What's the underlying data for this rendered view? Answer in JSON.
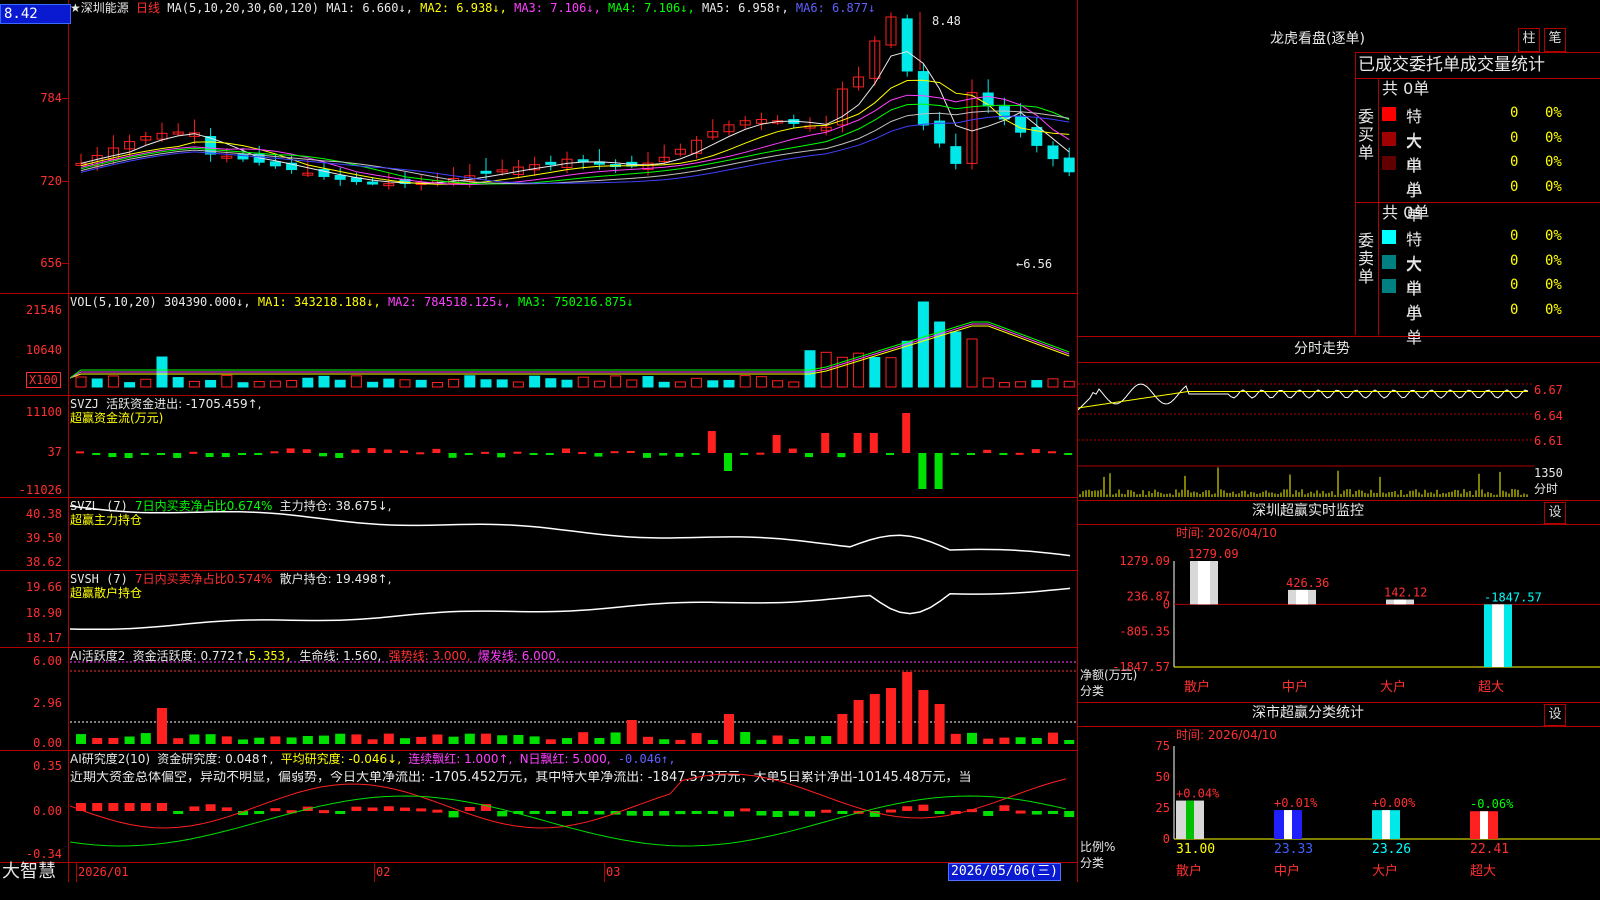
{
  "price_box": "8.42",
  "footer_brand": "大智慧",
  "dates": {
    "jan": "2026/01",
    "feb": "02",
    "mar": "03",
    "cursor": "2026/05/06(三)"
  },
  "main_chart": {
    "star": "★",
    "name": "深圳能源",
    "period": "日线",
    "ma_params": "MA(5,10,20,30,60,120)",
    "ma1": "MA1: 6.660↓,",
    "ma2": "MA2: 6.938↓,",
    "ma3": "MA3: 7.106↓,",
    "ma4": "MA4: 7.106↓,",
    "ma5": "MA5: 6.958↑,",
    "ma6": "MA6: 6.877↓",
    "y_ticks": [
      "784",
      "720",
      "656"
    ],
    "high_label": "8.48",
    "low_label": "6.56",
    "arrow_left": "←"
  },
  "vol_chart": {
    "title": "VOL(5,10,20)",
    "value": "304390.000↓,",
    "ma1": "MA1: 343218.188↓,",
    "ma2": "MA2: 784518.125↓,",
    "ma3": "MA3: 750216.875↓",
    "y_ticks": [
      "21546",
      "10640",
      "X100"
    ]
  },
  "svzj": {
    "title": "SVZJ",
    "text": "活跃资金进出: -1705.459↑,",
    "subtitle": "超赢资金流(万元)",
    "y_ticks": [
      "11100",
      "37",
      "-11026"
    ]
  },
  "svzl": {
    "title": "SVZL (7)",
    "net": "7日内买卖净占比0.674%",
    "hold": "主力持仓: 38.675↓,",
    "subtitle": "超赢主力持仓",
    "y_ticks": [
      "40.38",
      "39.50",
      "38.62"
    ]
  },
  "svsh": {
    "title": "SVSH (7)",
    "net": "7日内买卖净占比0.574%",
    "hold": "散户持仓: 19.498↑,",
    "subtitle": "超赢散户持仓",
    "y_ticks": [
      "19.66",
      "18.90",
      "18.17"
    ]
  },
  "ai_active": {
    "title": "AI活跃度2",
    "a": "资金活跃度: 0.772↑,",
    "b": "5.353,",
    "c": "生命线: 1.560,",
    "d": "强势线: 3.000,",
    "e": "爆发线: 6.000,",
    "y_ticks": [
      "6.00",
      "2.96",
      "0.00"
    ]
  },
  "ai_research": {
    "title": "AI研究度2(10)",
    "a": "资金研究度: 0.048↑,",
    "b": "平均研究度: -0.046↓,",
    "c": "连续飘红: 1.000↑,",
    "d": "N日飘红: 5.000,",
    "e": "-0.046↑,",
    "summary": "近期大资金总体偏空，异动不明显，偏弱势，今日大单净流出: -1705.452万元，其中特大单净流出: -1847.573万元，大单5日累计净出-10145.48万元，当",
    "y_ticks": [
      "0.35",
      "0.00",
      "-0.34"
    ]
  },
  "right_panel": {
    "tab_zhu": "柱",
    "tab_bi": "笔",
    "lhkp_title": "龙虎看盘(逐单)",
    "stat_title": "已成交委托单成交量统计",
    "buy_side": "委买单",
    "sell_side": "委卖单",
    "buy_total": "共 0单",
    "sell_total": "共 0单",
    "rows_buy": [
      {
        "label": "特大",
        "count": "0",
        "pct": "0%",
        "color": "#ff0000"
      },
      {
        "label": "大单",
        "count": "0",
        "pct": "0%",
        "color": "#a00000"
      },
      {
        "label": "中单",
        "count": "0",
        "pct": "0%",
        "color": "#600000"
      },
      {
        "label": "小单",
        "count": "0",
        "pct": "0%",
        "color": ""
      }
    ],
    "rows_sell": [
      {
        "label": "特大",
        "count": "0",
        "pct": "0%",
        "color": "#00ffff"
      },
      {
        "label": "大单",
        "count": "0",
        "pct": "0%",
        "color": "#008080"
      },
      {
        "label": "中单",
        "count": "0",
        "pct": "0%",
        "color": "#008080"
      },
      {
        "label": "小单",
        "count": "0",
        "pct": "0%",
        "color": ""
      }
    ],
    "intraday_title": "分时走势",
    "intraday_ticks": [
      "6.67",
      "6.64",
      "6.61"
    ],
    "intraday_vol": "1350",
    "intraday_vol_unit": "分时",
    "monitor_title": "深圳超赢实时监控",
    "set_label": "设",
    "monitor_time": "时间: 2026/04/10",
    "monitor_ticks": [
      "1279.09",
      "236.87",
      "0",
      "-805.35",
      "-1847.57"
    ],
    "monitor_values": [
      "1279.09",
      "426.36",
      "142.12",
      "-1847.57"
    ],
    "monitor_ylabel": "净额(万元)",
    "monitor_xlabel": "分类",
    "categories": [
      "散户",
      "中户",
      "大户",
      "超大"
    ],
    "class_title": "深市超赢分类统计",
    "class_time": "时间: 2026/04/10",
    "class_ticks": [
      "75",
      "50",
      "25",
      "0"
    ],
    "class_pcts": [
      "+0.04%",
      "+0.01%",
      "+0.00%",
      "-0.06%"
    ],
    "class_values": [
      "31.00",
      "23.33",
      "23.26",
      "22.41"
    ],
    "class_ylabel": "比例%",
    "class_xlabel": "分类"
  },
  "chart_data": [
    {
      "type": "bar",
      "title": "深圳超赢实时监控",
      "categories": [
        "散户",
        "中户",
        "大户",
        "超大"
      ],
      "values": [
        1279.09,
        426.36,
        142.12,
        -1847.57
      ],
      "ylabel": "净额(万元)",
      "xlabel": "分类",
      "ylim": [
        -1847.57,
        1279.09
      ]
    },
    {
      "type": "bar",
      "title": "深市超赢分类统计",
      "categories": [
        "散户",
        "中户",
        "大户",
        "超大"
      ],
      "values": [
        31.0,
        23.33,
        23.26,
        22.41
      ],
      "changes": [
        "+0.04%",
        "+0.01%",
        "+0.00%",
        "-0.06%"
      ],
      "ylabel": "比例%",
      "xlabel": "分类",
      "ylim": [
        0,
        75
      ]
    }
  ],
  "colors": {
    "up": "#ff2020",
    "down": "#00e8e8",
    "grid": "#b00000",
    "text_yellow": "#ffff00"
  }
}
